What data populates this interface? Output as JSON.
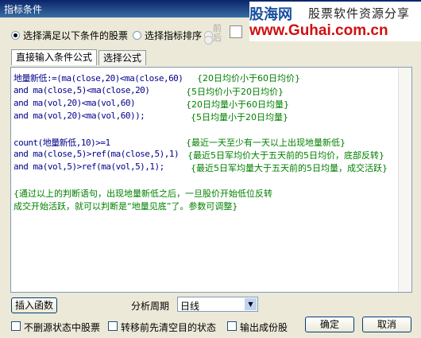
{
  "window": {
    "title": "指标条件"
  },
  "watermark": {
    "brand": "股海网",
    "tagline": "股票软件资源分享",
    "url": "www.Guhai.com.cn"
  },
  "selection": {
    "option1": "选择满足以下条件的股票",
    "option2": "选择指标排序",
    "spin_up": "前",
    "spin_down": "后"
  },
  "tabs": [
    "直接输入条件公式",
    "选择公式"
  ],
  "formula": {
    "lines": [
      {
        "code": "地量新低:=(ma(close,20)<ma(close,60)",
        "comment": "{20日均价小于60日均价}"
      },
      {
        "code": "and ma(close,5)<ma(close,20)",
        "comment": "{5日均价小于20日均价}"
      },
      {
        "code": "and ma(vol,20)<ma(vol,60)",
        "comment": "{20日均量小于60日均量}"
      },
      {
        "code": "and ma(vol,20)<ma(vol,60));",
        "comment": "{5日均量小于20日均量}"
      },
      {
        "code": "count(地量新低,10)>=1",
        "comment": "{最近一天至少有一天以上出现地量新低}"
      },
      {
        "code": "and ma(close,5)>ref(ma(close,5),1)",
        "comment": "{最近5日军均价大于五天前的5日均价，底部反转}"
      },
      {
        "code": "and ma(vol,5)>ref(ma(vol,5),1);",
        "comment": "{最近5日军均量大于五天前的5日均量，成交活跃}"
      }
    ],
    "note_line1": "{通过以上的判断语句，出现地量新低之后，一旦股价开始低位反转",
    "note_line2": "成交开始活跃，就可以判断是“地量见底”了。参数可调整}"
  },
  "controls": {
    "insert_function": "插入函数",
    "period_label": "分析周期",
    "period_value": "日线",
    "ok": "确定",
    "cancel": "取消",
    "check1": "不删源状态中股票",
    "check2": "转移前先清空目的状态",
    "check3": "输出成份股"
  }
}
